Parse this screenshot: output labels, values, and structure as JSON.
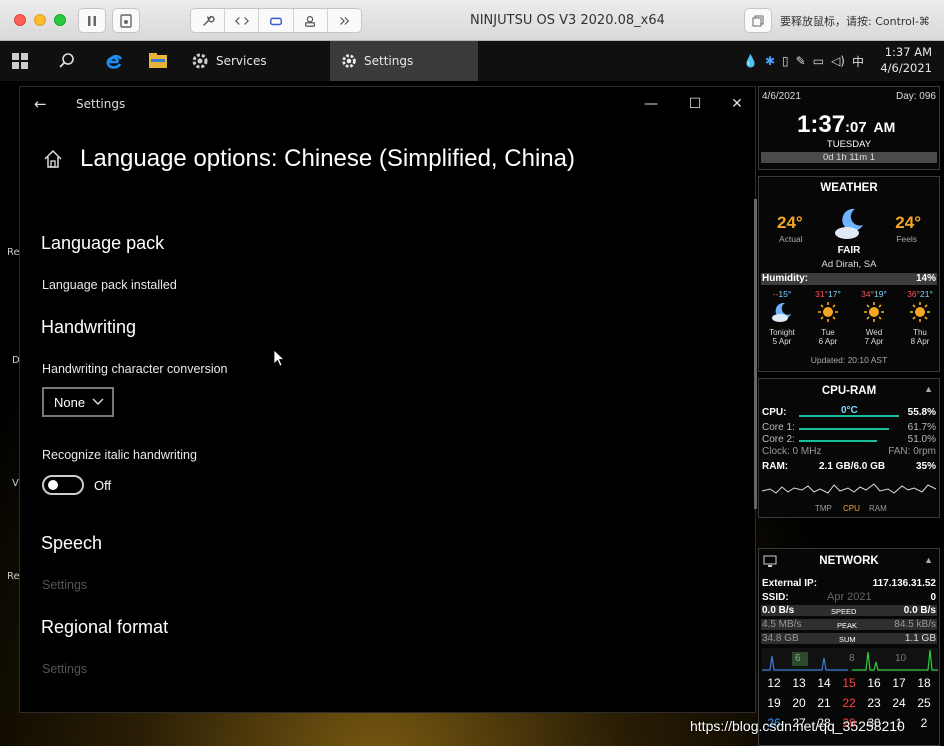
{
  "host": {
    "title": "NINJUTSU OS V3 2020.08_x64",
    "release_hint": "要释放鼠标，请按: Control-⌘"
  },
  "taskbar": {
    "services_label": "Services",
    "settings_label": "Settings",
    "tray_lang": "中",
    "clock_time": "1:37 AM",
    "clock_date": "4/6/2021"
  },
  "window": {
    "title": "Settings",
    "page_title": "Language options: Chinese (Simplified, China)",
    "language_pack": {
      "heading": "Language pack",
      "status": "Language pack installed"
    },
    "handwriting": {
      "heading": "Handwriting",
      "conversion_label": "Handwriting character conversion",
      "conversion_value": "None",
      "italic_label": "Recognize italic handwriting",
      "italic_state": "Off"
    },
    "speech": {
      "heading": "Speech",
      "link": "Settings"
    },
    "regional": {
      "heading": "Regional format",
      "link": "Settings"
    }
  },
  "edge_fragments": [
    "Re",
    "D",
    "V",
    "Re"
  ],
  "widgets": {
    "clock": {
      "date": "4/6/2021",
      "day": "Day: 096",
      "time_hm": "1:37",
      "time_s": ":07",
      "ampm": "AM",
      "weekday": "TUESDAY",
      "uptime": "0d 1h 11m 1"
    },
    "weather": {
      "title": "WEATHER",
      "actual": "24°",
      "actual_label": "Actual",
      "feels": "24°",
      "feels_label": "Feels",
      "condition": "FAIR",
      "location": "Ad Dirah, SA",
      "humidity_label": "Humidity:",
      "humidity": "14%",
      "forecast": [
        {
          "lo": "--",
          "hi": "15°",
          "day": "Tonight",
          "date": "5 Apr",
          "icon": "moon-icon"
        },
        {
          "lo": "31°",
          "hi": "17°",
          "day": "Tue",
          "date": "6 Apr",
          "icon": "sun-icon"
        },
        {
          "lo": "34°",
          "hi": "19°",
          "day": "Wed",
          "date": "7 Apr",
          "icon": "sun-icon"
        },
        {
          "lo": "36°",
          "hi": "21°",
          "day": "Thu",
          "date": "8 Apr",
          "icon": "sun-icon"
        }
      ],
      "updated": "Updated: 20:10 AST"
    },
    "cpu": {
      "title": "CPU-RAM",
      "cpu_label": "CPU:",
      "cpu_temp": "0°C",
      "cpu_pct": "55.8%",
      "core1_label": "Core 1:",
      "core1": "61.7%",
      "core2_label": "Core 2:",
      "core2": "51.0%",
      "clock_label": "Clock: 0 MHz",
      "fan_label": "FAN: 0rpm",
      "ram_label": "RAM:",
      "ram_value": "2.1 GB/6.0 GB",
      "ram_pct": "35%",
      "tabs": [
        "TMP",
        "CPU",
        "RAM"
      ]
    },
    "network": {
      "title": "NETWORK",
      "ext_ip_label": "External IP:",
      "ext_ip": "117.136.31.52",
      "ssid_label": "SSID:",
      "ssid_overlay": "Apr 2021",
      "ssid": "0",
      "down_speed": "0.0 B/s",
      "speed_label": "SPEED",
      "up_speed": "0.0 B/s",
      "down_peak": "4.5 MB/s",
      "peak_label": "PEAK",
      "up_peak": "84.5 kB/s",
      "down_sum": "34.8 GB",
      "sum_label": "SUM",
      "up_sum": "1.1 GB",
      "graph_nums": [
        "6",
        "8",
        "10"
      ],
      "calendar_rows": [
        [
          "12",
          "13",
          "14",
          "15",
          "16",
          "17",
          "18"
        ],
        [
          "19",
          "20",
          "21",
          "22",
          "23",
          "24",
          "25"
        ],
        [
          "26",
          "27",
          "28",
          "29",
          "30",
          "1",
          "2"
        ]
      ]
    }
  },
  "watermark": "https://blog.csdn.net/qq_35258210"
}
